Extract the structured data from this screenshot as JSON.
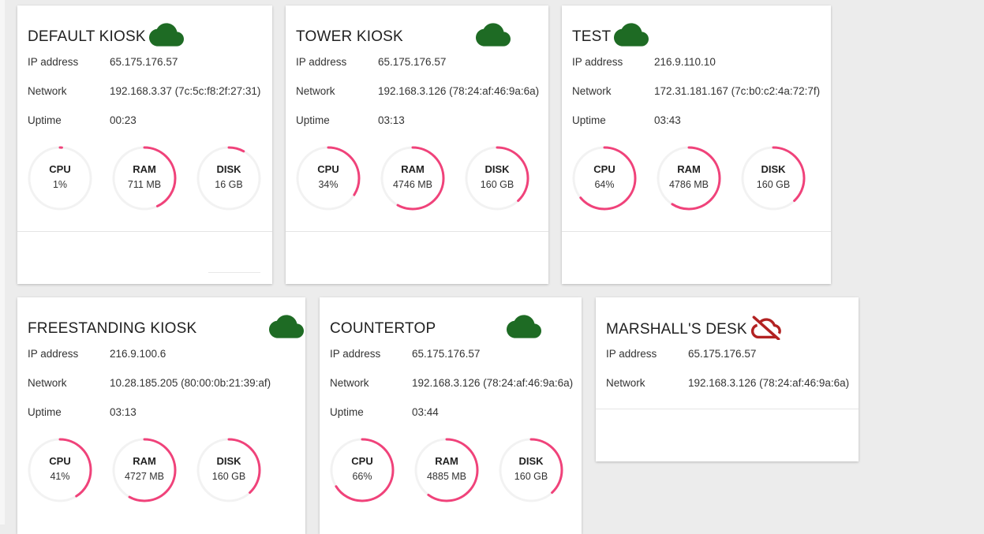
{
  "accent_color": "#f0427a",
  "gauge_track_color": "#f2f2f2",
  "online_icon_color": "#1e6b24",
  "offline_icon_color": "#b22222",
  "labels": {
    "ip": "IP address",
    "network": "Network",
    "uptime": "Uptime",
    "cpu": "CPU",
    "ram": "RAM",
    "disk": "DISK"
  },
  "devices": [
    {
      "name": "DEFAULT KIOSK",
      "status": "online",
      "status_icon": "cloud-icon",
      "ip": "65.175.176.57",
      "network": "192.168.3.37 (7c:5c:f8:2f:27:31)",
      "uptime": "00:23",
      "cpu": {
        "value": "1%",
        "fraction": 0.01
      },
      "ram": {
        "value": "711 MB",
        "fraction": 0.43
      },
      "disk": {
        "value": "16 GB",
        "fraction": 0.08
      }
    },
    {
      "name": "TOWER KIOSK",
      "status": "online",
      "status_icon": "cloud-icon",
      "ip": "65.175.176.57",
      "network": "192.168.3.126 (78:24:af:46:9a:6a)",
      "uptime": "03:13",
      "cpu": {
        "value": "34%",
        "fraction": 0.34
      },
      "ram": {
        "value": "4746 MB",
        "fraction": 0.58
      },
      "disk": {
        "value": "160 GB",
        "fraction": 0.38
      }
    },
    {
      "name": "TEST",
      "status": "online",
      "status_icon": "cloud-icon",
      "ip": "216.9.110.10",
      "network": "172.31.181.167 (7c:b0:c2:4a:72:7f)",
      "uptime": "03:43",
      "cpu": {
        "value": "64%",
        "fraction": 0.64
      },
      "ram": {
        "value": "4786 MB",
        "fraction": 0.59
      },
      "disk": {
        "value": "160 GB",
        "fraction": 0.38
      }
    },
    {
      "name": "FREESTANDING KIOSK",
      "status": "online",
      "status_icon": "cloud-icon",
      "ip": "216.9.100.6",
      "network": "10.28.185.205 (80:00:0b:21:39:af)",
      "uptime": "03:13",
      "cpu": {
        "value": "41%",
        "fraction": 0.41
      },
      "ram": {
        "value": "4727 MB",
        "fraction": 0.58
      },
      "disk": {
        "value": "160 GB",
        "fraction": 0.38
      }
    },
    {
      "name": "COUNTERTOP",
      "status": "online",
      "status_icon": "cloud-icon",
      "ip": "65.175.176.57",
      "network": "192.168.3.126 (78:24:af:46:9a:6a)",
      "uptime": "03:44",
      "cpu": {
        "value": "66%",
        "fraction": 0.66
      },
      "ram": {
        "value": "4885 MB",
        "fraction": 0.6
      },
      "disk": {
        "value": "160 GB",
        "fraction": 0.38
      }
    },
    {
      "name": "MARSHALL'S DESK",
      "status": "offline",
      "status_icon": "cloud-off-icon",
      "ip": "65.175.176.57",
      "network": "192.168.3.126 (78:24:af:46:9a:6a)"
    }
  ]
}
